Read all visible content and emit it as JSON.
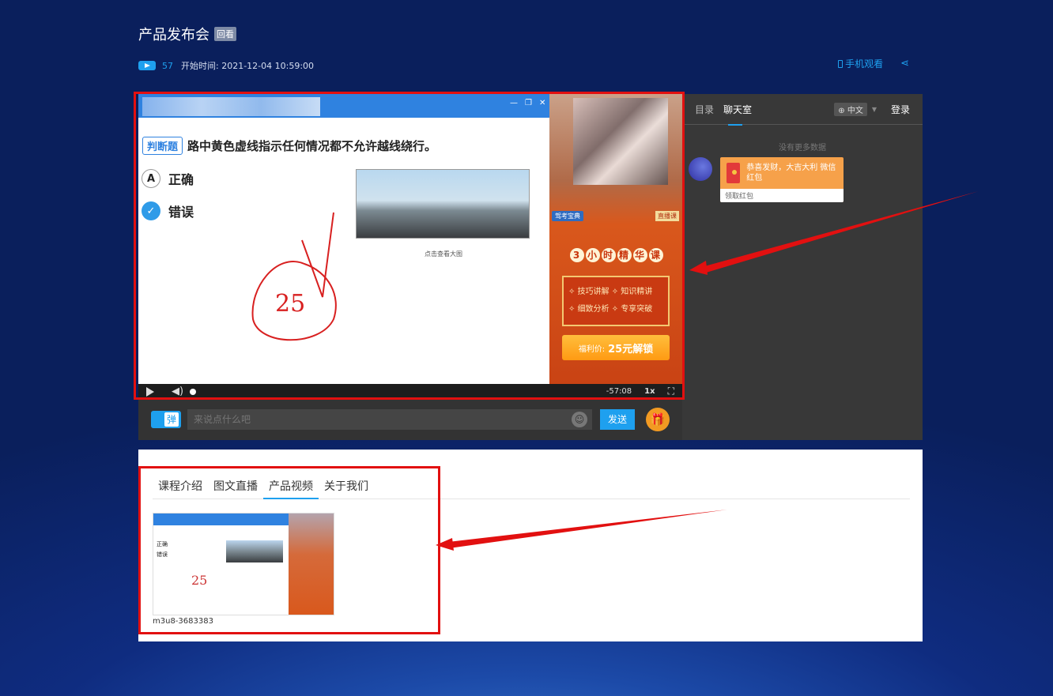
{
  "header": {
    "title": "产品发布会",
    "badge": "回看",
    "view_count": "57",
    "start_time": "开始时间: 2021-12-04 10:59:00",
    "mobile_label": "手机观看"
  },
  "player": {
    "question_tag": "判断题",
    "question_text": "路中黄色虚线指示任何情况都不允许越线绕行。",
    "option_a_letter": "A",
    "option_a": "正确",
    "option_b": "错误",
    "scene_caption": "点击查看大图",
    "handwriting": "25",
    "time": "-57:08",
    "speed": "1x",
    "promo": {
      "tag": "驾考宝典",
      "live": "直播课",
      "headline": [
        "3",
        "小",
        "时",
        "精",
        "华",
        "课"
      ],
      "features": [
        "✧ 技巧讲解 ✧ 知识精讲",
        "✧ 细致分析 ✧ 专享突破"
      ],
      "price_label": "福利价:",
      "price_value": "25元解锁"
    }
  },
  "chatbar": {
    "danmu_label": "弹",
    "placeholder": "来说点什么吧",
    "send_label": "发送"
  },
  "side": {
    "tab_catalog": "目录",
    "tab_chat": "聊天室",
    "lang": "⊕ 中文",
    "login": "登录",
    "no_more": "没有更多数据",
    "redpack_text": "恭喜发财，大吉大利 微信红包",
    "redpack_action": "领取红包"
  },
  "content": {
    "tabs": [
      "课程介绍",
      "图文直播",
      "产品视频",
      "关于我们"
    ],
    "active_tab": "产品视频",
    "video_caption": "m3u8-3683383"
  },
  "colors": {
    "accent": "#1ea0ef",
    "annotation": "#e21010"
  }
}
